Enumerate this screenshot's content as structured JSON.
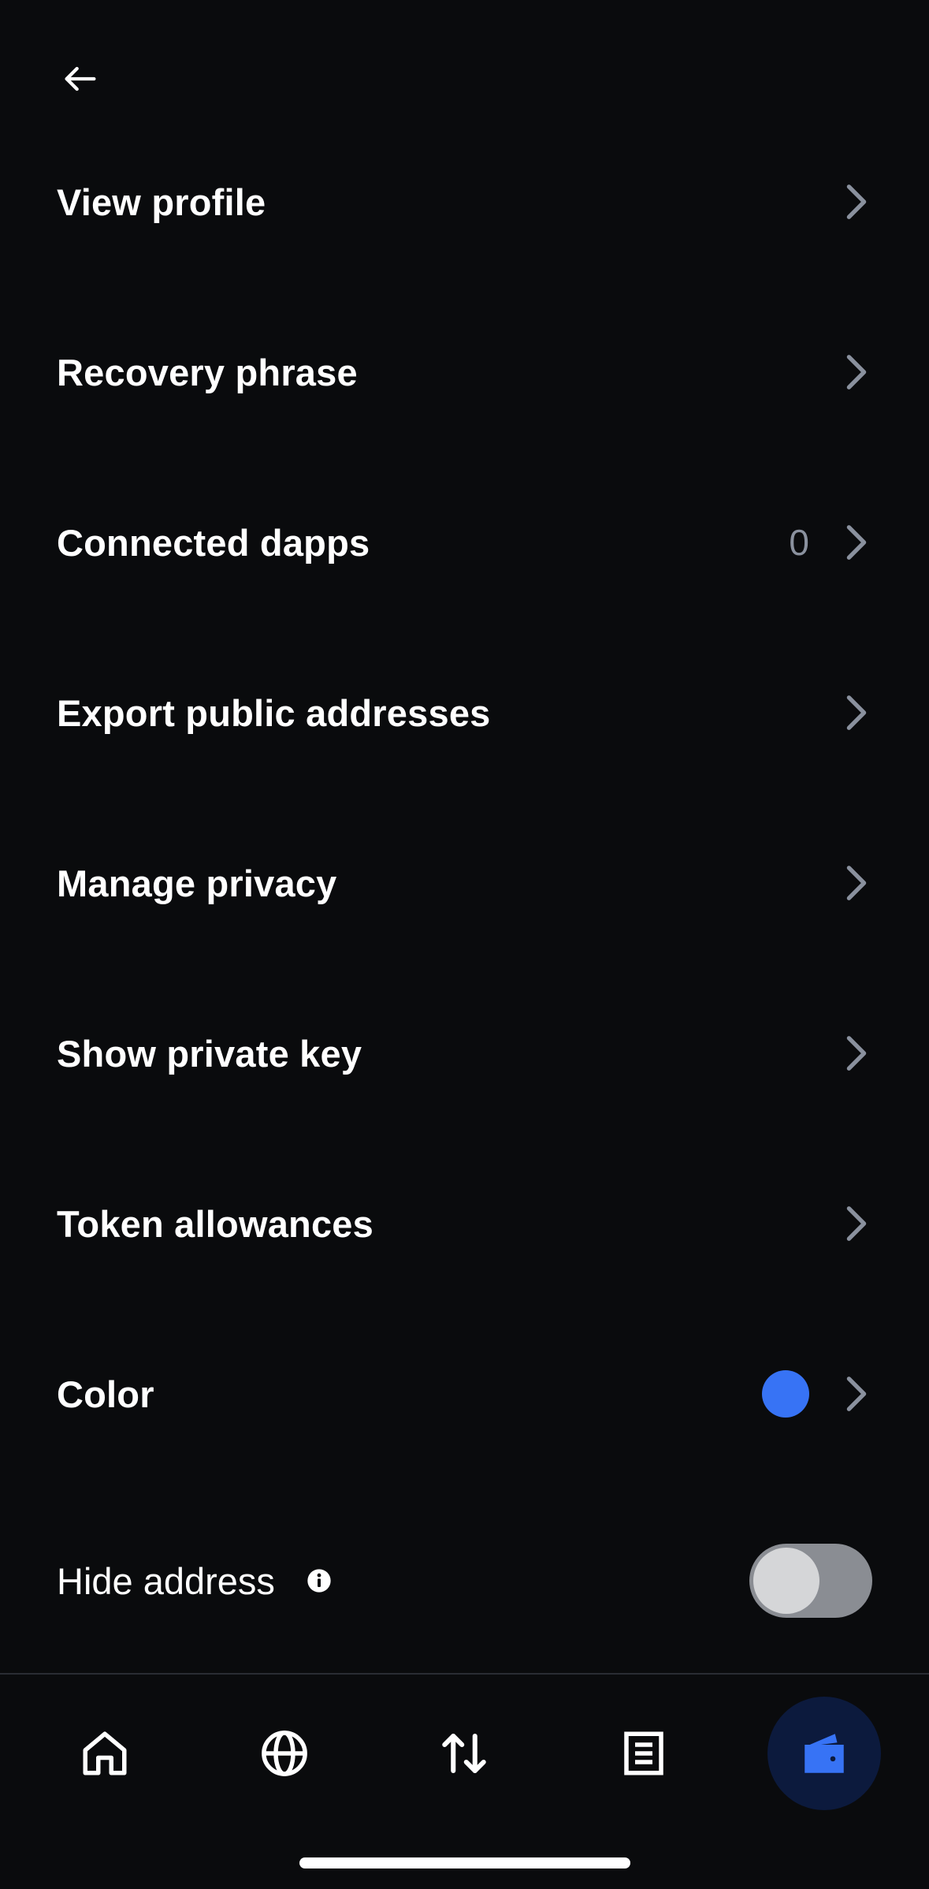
{
  "header": {
    "back_icon": "arrow-left-icon"
  },
  "menu": {
    "items": [
      {
        "label": "View profile",
        "icon": "chevron-right-icon"
      },
      {
        "label": "Recovery phrase",
        "icon": "chevron-right-icon"
      },
      {
        "label": "Connected dapps",
        "count": "0",
        "icon": "chevron-right-icon"
      },
      {
        "label": "Export public addresses",
        "icon": "chevron-right-icon"
      },
      {
        "label": "Manage privacy",
        "icon": "chevron-right-icon"
      },
      {
        "label": "Show private key",
        "icon": "chevron-right-icon"
      },
      {
        "label": "Token allowances",
        "icon": "chevron-right-icon"
      },
      {
        "label": "Color",
        "swatch_color": "#3773f5",
        "icon": "chevron-right-icon"
      }
    ]
  },
  "hide_address": {
    "label": "Hide address",
    "info_icon": "info-icon",
    "enabled": false
  },
  "tabbar": {
    "tabs": [
      {
        "icon": "home-icon",
        "active": false
      },
      {
        "icon": "globe-icon",
        "active": false
      },
      {
        "icon": "swap-arrows-icon",
        "active": false
      },
      {
        "icon": "document-list-icon",
        "active": false
      },
      {
        "icon": "wallet-icon",
        "active": true
      }
    ]
  },
  "colors": {
    "background": "#0a0b0d",
    "accent": "#3773f5",
    "muted_text": "#8a919e",
    "active_tab_bg": "#0c1a3d"
  }
}
